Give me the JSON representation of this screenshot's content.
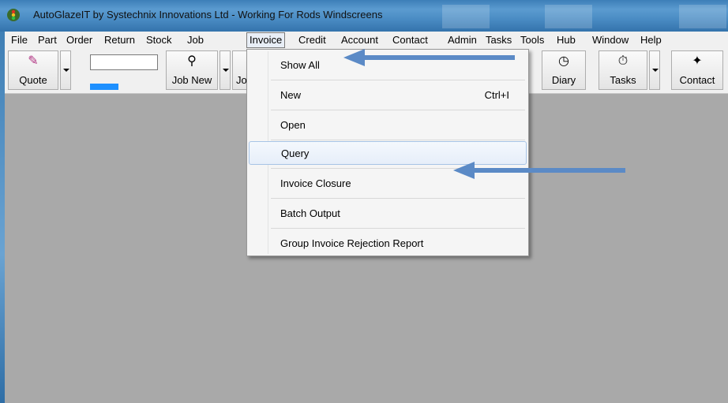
{
  "window": {
    "title": "AutoGlazeIT by Systechnix Innovations Ltd -  Working For Rods Windscreens"
  },
  "menubar": {
    "items": [
      {
        "label": "File"
      },
      {
        "label": "Part"
      },
      {
        "label": "Order"
      },
      {
        "label": "Return"
      },
      {
        "label": "Stock"
      },
      {
        "label": "Job"
      },
      {
        "label": "Invoice",
        "active": true
      },
      {
        "label": "Credit"
      },
      {
        "label": "Account"
      },
      {
        "label": "Contact"
      },
      {
        "label": "Admin"
      },
      {
        "label": "Tasks"
      },
      {
        "label": "Tools"
      },
      {
        "label": "Hub"
      },
      {
        "label": "Window"
      },
      {
        "label": "Help"
      }
    ]
  },
  "toolbar": {
    "quote_label": "Quote",
    "job_new_label": "Job New",
    "jo_partial_label": "Jo",
    "diary_label": "Diary",
    "tasks_label": "Tasks",
    "contact_label": "Contact",
    "search_value": ""
  },
  "invoice_menu": {
    "items": [
      {
        "label": "Show All",
        "shortcut": ""
      },
      {
        "label": "New",
        "shortcut": "Ctrl+I"
      },
      {
        "label": "Open",
        "shortcut": ""
      },
      {
        "label": "Query",
        "shortcut": "",
        "highlighted": true
      },
      {
        "label": "Invoice Closure",
        "shortcut": ""
      },
      {
        "label": "Batch Output",
        "shortcut": ""
      },
      {
        "label": "Group Invoice Rejection Report",
        "shortcut": ""
      }
    ]
  },
  "colors": {
    "arrow": "#5b8ac6",
    "highlight_border": "#a7c4e6",
    "progress": "#1e90ff",
    "workspace": "#a9a9a9"
  }
}
